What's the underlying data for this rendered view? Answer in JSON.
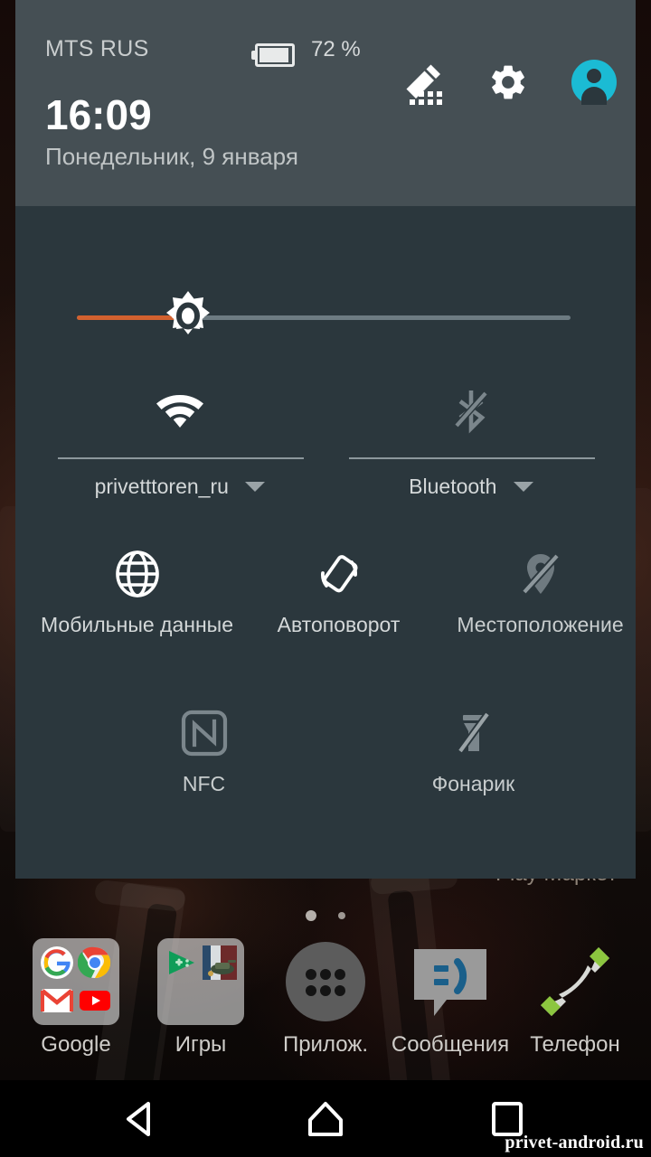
{
  "status_bar": {
    "carrier": "MTS RUS",
    "battery_percent": "72 %",
    "battery_level": 72,
    "battery_icon": "battery-icon",
    "edit_icon": "edit-tiles-icon",
    "settings_icon": "gear-icon",
    "avatar_icon": "user-avatar-icon",
    "avatar_color": "#1bbbd4"
  },
  "header": {
    "clock": "16:09",
    "date": "Понедельник, 9 января"
  },
  "brightness": {
    "icon": "brightness-sun-icon",
    "value_percent": 17,
    "fill_color": "#d2612f",
    "track_color": "#6d7b82"
  },
  "dual_tiles": [
    {
      "name": "wifi",
      "icon": "wifi-icon",
      "label": "privetttoren_ru",
      "enabled": true,
      "caret": "chevron-down-icon"
    },
    {
      "name": "bluetooth",
      "icon": "bluetooth-off-icon",
      "label": "Bluetooth",
      "enabled": false,
      "caret": "chevron-down-icon"
    }
  ],
  "tiles": [
    {
      "name": "mobile-data",
      "icon": "globe-icon",
      "label": "Мобильные данные",
      "enabled": true
    },
    {
      "name": "auto-rotate",
      "icon": "auto-rotate-icon",
      "label": "Автоповорот",
      "enabled": true
    },
    {
      "name": "location",
      "icon": "location-off-icon",
      "label": "Местоположение",
      "enabled": false
    },
    {
      "name": "nfc",
      "icon": "nfc-icon",
      "label": "NFC",
      "enabled": false
    },
    {
      "name": "flashlight",
      "icon": "flashlight-off-icon",
      "label": "Фонарик",
      "enabled": false
    }
  ],
  "home_screen": {
    "partial_widget_label": "Play Маркет",
    "page_dots": {
      "count": 2,
      "active_index": 0
    },
    "dock": [
      {
        "name": "google-folder",
        "label": "Google",
        "icon": "folder-icon"
      },
      {
        "name": "games-folder",
        "label": "Игры",
        "icon": "folder-icon"
      },
      {
        "name": "app-drawer",
        "label": "Прилож.",
        "icon": "app-drawer-icon"
      },
      {
        "name": "messages",
        "label": "Сообщения",
        "icon": "messages-icon"
      },
      {
        "name": "phone",
        "label": "Телефон",
        "icon": "phone-icon"
      }
    ]
  },
  "nav_bar": {
    "back_icon": "back-triangle-icon",
    "home_icon": "home-icon",
    "recents_icon": "recents-square-icon"
  },
  "watermark": "privet-android.ru",
  "colors": {
    "panel_header_bg": "#454f54",
    "panel_body_bg": "#2b373d",
    "icon_active": "#ffffff",
    "icon_disabled": "#7b868c",
    "text_primary": "#ffffff",
    "text_secondary": "#c9cdce"
  }
}
